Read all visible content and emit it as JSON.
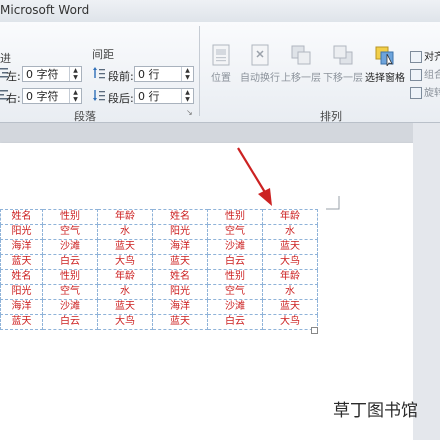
{
  "window": {
    "title": "Microsoft Word"
  },
  "paragraph_group": {
    "indent_label_partial": "进",
    "left_label": "左:",
    "left_value": "0 字符",
    "right_label": "右:",
    "right_value": "0 字符",
    "spacing_title": "间距",
    "before_label": "段前:",
    "before_value": "0 行",
    "after_label": "段后:",
    "after_value": "0 行",
    "group_label": "段落"
  },
  "arrange_group": {
    "position_label": "位置",
    "wrap_label": "自动换行",
    "bring_forward_label": "上移一层",
    "send_backward_label": "下移一层",
    "selection_pane_label": "选择窗格",
    "align_label": "对齐",
    "group_label_small": "组合",
    "rotate_label": "旋转",
    "group_label": "排列"
  },
  "table": {
    "rows": [
      [
        "姓名",
        "性别",
        "年龄",
        "姓名",
        "性别",
        "年龄"
      ],
      [
        "阳光",
        "空气",
        "水",
        "阳光",
        "空气",
        "水"
      ],
      [
        "海洋",
        "沙滩",
        "蓝天",
        "海洋",
        "沙滩",
        "蓝天"
      ],
      [
        "蓝天",
        "白云",
        "大鸟",
        "蓝天",
        "白云",
        "大鸟"
      ],
      [
        "姓名",
        "性别",
        "年龄",
        "姓名",
        "性别",
        "年龄"
      ],
      [
        "阳光",
        "空气",
        "水",
        "阳光",
        "空气",
        "水"
      ],
      [
        "海洋",
        "沙滩",
        "蓝天",
        "海洋",
        "沙滩",
        "蓝天"
      ],
      [
        "蓝天",
        "白云",
        "大鸟",
        "蓝天",
        "白云",
        "大鸟"
      ]
    ]
  },
  "watermark": {
    "text": "草丁图书馆"
  },
  "colors": {
    "table_text": "#cc1f1f",
    "table_border": "#8fb3d9",
    "arrow": "#cc2222"
  }
}
